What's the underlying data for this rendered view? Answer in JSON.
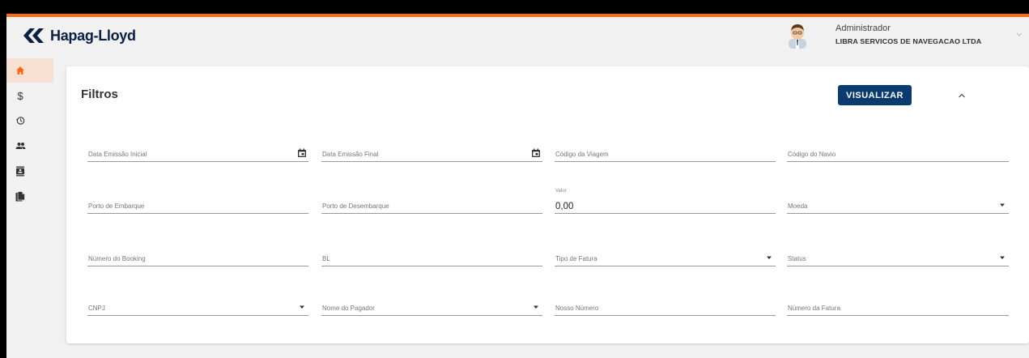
{
  "header": {
    "logo_text": "Hapag-Lloyd",
    "user_name": "Administrador",
    "user_company": "LIBRA SERVICOS DE NAVEGACAO LTDA",
    "brand_orange": "#ff6a13",
    "brand_navy": "#0a1f44"
  },
  "sidebar": {
    "items": [
      {
        "icon": "home-icon",
        "active": true
      },
      {
        "icon": "dollar-icon",
        "active": false
      },
      {
        "icon": "history-icon",
        "active": false
      },
      {
        "icon": "people-icon",
        "active": false
      },
      {
        "icon": "contact-card-icon",
        "active": false
      },
      {
        "icon": "document-icon",
        "active": false
      }
    ]
  },
  "filters": {
    "title": "Filtros",
    "visualizar_label": "VISUALIZAR",
    "rows": [
      [
        {
          "label": "Data Emissão Inicial",
          "suffix": "calendar-icon"
        },
        {
          "label": "Data Emissão Final",
          "suffix": "calendar-icon"
        },
        {
          "label": "Código da Viagem"
        },
        {
          "label": "Código do Navio"
        }
      ],
      [
        {
          "label": "Porto de Embarque"
        },
        {
          "label": "Porto de Desembarque"
        },
        {
          "label": "Valor",
          "value": "0,00"
        },
        {
          "label": "Moeda",
          "suffix": "dropdown-arrow-icon"
        }
      ],
      [
        {
          "label": "Número do Booking"
        },
        {
          "label": "BL"
        },
        {
          "label": "Tipo de Fatura",
          "suffix": "dropdown-arrow-icon"
        },
        {
          "label": "Status",
          "suffix": "dropdown-arrow-icon"
        }
      ],
      [
        {
          "label": "CNPJ",
          "suffix": "dropdown-arrow-icon"
        },
        {
          "label": "Nome do Pagador",
          "suffix": "dropdown-arrow-icon"
        },
        {
          "label": "Nosso Número"
        },
        {
          "label": "Número da Fatura"
        }
      ]
    ]
  }
}
